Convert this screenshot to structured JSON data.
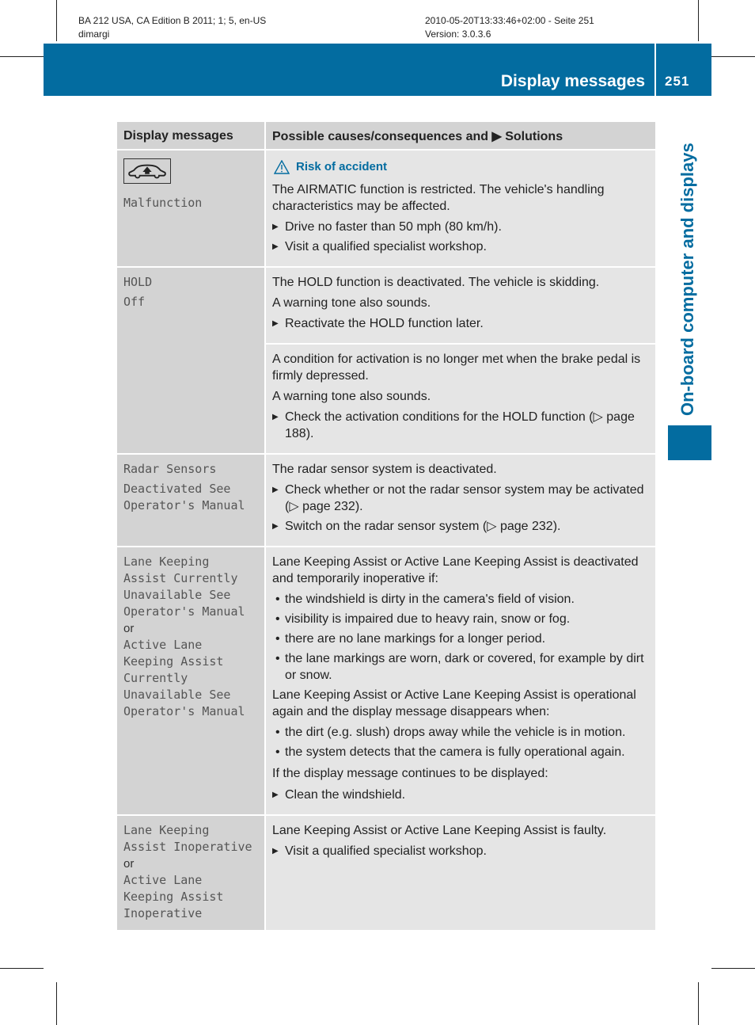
{
  "meta": {
    "left_line1": "BA 212 USA, CA Edition B 2011; 1; 5, en-US",
    "left_line2": "dimargi",
    "right_line1": "2010-05-20T13:33:46+02:00 - Seite 251",
    "right_line2": "Version: 3.0.3.6"
  },
  "banner": {
    "title": "Display messages",
    "page": "251",
    "color": "#036ca0"
  },
  "side_tab": {
    "title": "On-board computer and displays"
  },
  "table": {
    "headers": [
      "Display messages",
      "Possible causes/consequences and ▶ Solutions"
    ],
    "rows": [
      {
        "icon": "car-airmatic-icon",
        "message": [
          "Malfunction"
        ],
        "warning": "Risk of accident",
        "text": [
          "The AIRMATIC function is restricted. The vehicle's handling characteristics may be affected."
        ],
        "steps": [
          "Drive no faster than 50 mph (80 km/h).",
          "Visit a qualified specialist workshop."
        ]
      },
      {
        "message": [
          "HOLD",
          "Off"
        ],
        "part1": {
          "text": [
            "The HOLD function is deactivated. The vehicle is skidding.",
            "A warning tone also sounds."
          ],
          "steps": [
            "Reactivate the HOLD function later."
          ]
        },
        "part2": {
          "text": [
            "A condition for activation is no longer met when the brake pedal is firmly depressed.",
            "A warning tone also sounds."
          ],
          "steps": [
            "Check the activation conditions for the HOLD function (▷ page 188)."
          ]
        }
      },
      {
        "message": [
          "Radar Sensors",
          "Deactivated See",
          "Operator's Manual"
        ],
        "text": [
          "The radar sensor system is deactivated."
        ],
        "steps": [
          "Check whether or not the radar sensor system may be activated (▷ page 232).",
          "Switch on the radar sensor system (▷ page 232)."
        ]
      },
      {
        "message_a": [
          "Lane Keeping",
          "Assist Currently",
          "Unavailable See",
          "Operator's Manual"
        ],
        "or": "or",
        "message_b": [
          "Active Lane",
          "Keeping Assist",
          "Currently",
          "Unavailable See",
          "Operator's Manual"
        ],
        "intro1": "Lane Keeping Assist or Active Lane Keeping Assist is deactivated and temporarily inoperative if:",
        "bullets1": [
          "the windshield is dirty in the camera's field of vision.",
          "visibility is impaired due to heavy rain, snow or fog.",
          "there are no lane markings for a longer period.",
          "the lane markings are worn, dark or covered, for example by dirt or snow."
        ],
        "intro2": "Lane Keeping Assist or Active Lane Keeping Assist is operational again and the display message disappears when:",
        "bullets2": [
          "the dirt (e.g. slush) drops away while the vehicle is in motion.",
          "the system detects that the camera is fully operational again."
        ],
        "intro3": "If the display message continues to be displayed:",
        "steps": [
          "Clean the windshield."
        ]
      },
      {
        "message_a": [
          "Lane Keeping",
          "Assist Inoperative"
        ],
        "or": "or",
        "message_b": [
          "Active Lane",
          "Keeping Assist",
          "Inoperative"
        ],
        "text": [
          "Lane Keeping Assist or Active Lane Keeping Assist is faulty."
        ],
        "steps": [
          "Visit a qualified specialist workshop."
        ]
      }
    ]
  }
}
